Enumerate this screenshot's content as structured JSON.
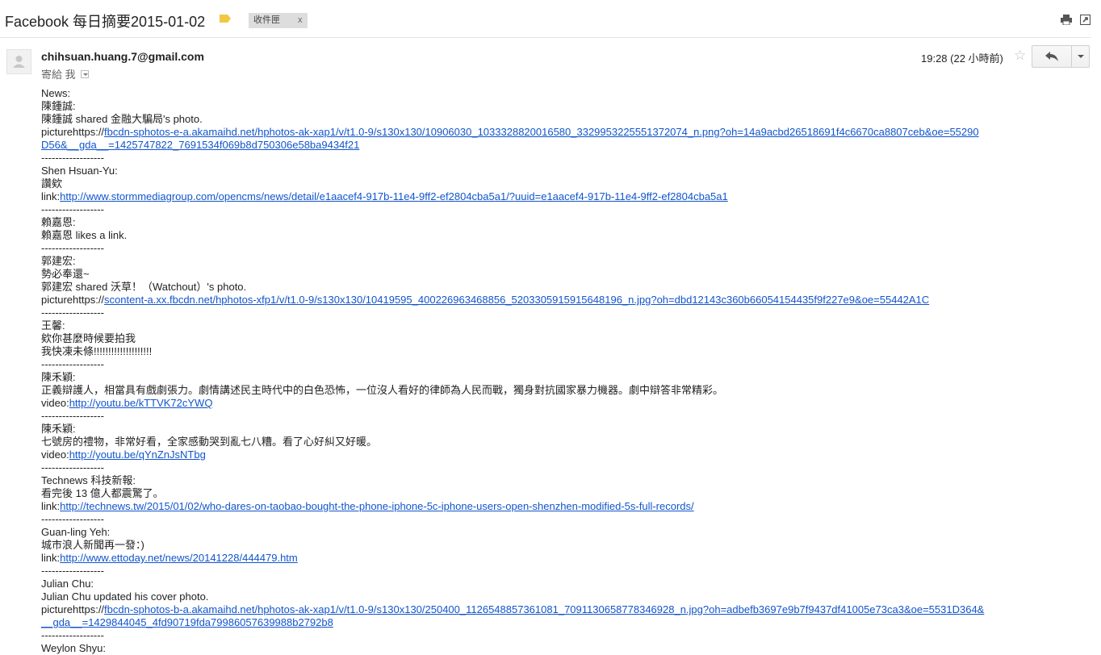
{
  "header": {
    "subject": "Facebook 每日摘要2015-01-02",
    "label_chip": "收件匣",
    "label_chip_close": "x"
  },
  "icons": {
    "label_tag": "label-tag-icon",
    "print": "print-icon",
    "new_window": "open-new-window-icon",
    "star": "star-icon",
    "reply": "reply-icon",
    "more": "chevron-down-icon"
  },
  "colors": {
    "link": "#1155cc",
    "label_tag": "#f2c744"
  },
  "message": {
    "sender": "chihsuan.huang.7@gmail.com",
    "to_label": "寄給 我",
    "time": "19:28 (22 小時前)",
    "star": "☆"
  },
  "body": {
    "separator": "------------------",
    "news_heading": "News:",
    "posts": [
      {
        "author": " 陳鍾誠:",
        "lines": [
          "陳鍾誠 shared 金融大騙局's photo."
        ],
        "link_prefix": "picturehttps://",
        "link_text": "fbcdn-sphotos-e-a.akamaihd.net/hphotos-ak-xap1/v/t1.0-9/s130x130/10906030_1033328820016580_3329953225551372074_n.png?oh=14a9acbd26518691f4c6670ca8807ceb&oe=55290D56&__gda__=1425747822_7691534f069b8d750306e58ba9434f21"
      },
      {
        "author": "Shen Hsuan-Yu:",
        "lines": [
          "讚欸"
        ],
        "link_prefix": "link:",
        "link_text": "http://www.stormmediagroup.com/opencms/news/detail/e1aacef4-917b-11e4-9ff2-ef2804cba5a1/?uuid=e1aacef4-917b-11e4-9ff2-ef2804cba5a1"
      },
      {
        "author": "賴嘉恩:",
        "lines": [
          "賴嘉恩 likes a link."
        ],
        "link_prefix": "",
        "link_text": ""
      },
      {
        "author": "郭建宏:",
        "lines": [
          "勢必奉還~",
          "郭建宏 shared 沃草！（Watchout）'s photo."
        ],
        "link_prefix": "picturehttps://",
        "link_text": "scontent-a.xx.fbcdn.net/hphotos-xfp1/v/t1.0-9/s130x130/10419595_400226963468856_5203305915915648196_n.jpg?oh=dbd12143c360b66054154435f9f227e9&oe=55442A1C"
      },
      {
        "author": "王馨:",
        "lines": [
          "欸你甚麼時候要拍我",
          "我快凍未條!!!!!!!!!!!!!!!!!!!!"
        ],
        "link_prefix": "",
        "link_text": ""
      },
      {
        "author": "陳禾穎:",
        "lines": [
          "正義辯護人，相當具有戲劇張力。劇情講述民主時代中的白色恐怖，一位沒人看好的律師為人民而戰，獨身對抗國家暴力機器。劇中辯答非常精彩。"
        ],
        "link_prefix": "video:",
        "link_text": "http://youtu.be/kTTVK72cYWQ"
      },
      {
        "author": "陳禾穎:",
        "lines": [
          "七號房的禮物，非常好看，全家感動哭到亂七八糟。看了心好糾又好暖。"
        ],
        "link_prefix": "video:",
        "link_text": "http://youtu.be/qYnZnJsNTbg"
      },
      {
        "author": "Technews 科技新報:",
        "lines": [
          "看完後 13 億人都震驚了。"
        ],
        "link_prefix": "link:",
        "link_text": "http://technews.tw/2015/01/02/who-dares-on-taobao-bought-the-phone-iphone-5c-iphone-users-open-shenzhen-modified-5s-full-records/"
      },
      {
        "author": "Guan-ling Yeh:",
        "lines": [
          "城市浪人新聞再一發：)"
        ],
        "link_prefix": "link:",
        "link_text": "http://www.ettoday.net/news/20141228/444479.htm"
      },
      {
        "author": "Julian Chu:",
        "lines": [
          "Julian Chu updated his cover photo."
        ],
        "link_prefix": "picturehttps://",
        "link_text": "fbcdn-sphotos-b-a.akamaihd.net/hphotos-ak-xap1/v/t1.0-9/s130x130/250400_1126548857361081_7091130658778346928_n.jpg?oh=adbefb3697e9b7f9437df41005e73ca3&oe=5531D364&__gda__=1429844045_4fd90719fda79986057639988b2792b8"
      },
      {
        "author": "Weylon Shyu:",
        "lines": [],
        "link_prefix": "",
        "link_text": ""
      }
    ]
  }
}
